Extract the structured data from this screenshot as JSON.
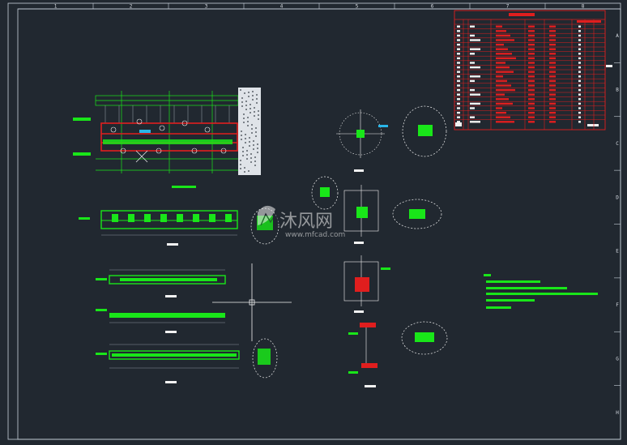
{
  "drawing": {
    "zone_columns": [
      "1",
      "2",
      "3",
      "4",
      "5",
      "6",
      "7",
      "8"
    ],
    "zone_rows": [
      "A",
      "B",
      "C",
      "D",
      "E",
      "F",
      "G",
      "H"
    ]
  },
  "watermark": {
    "brand": "沐风网",
    "url": "www.mfcad.com",
    "logo_icon": "leaf-m-logo-icon"
  },
  "colors": {
    "background": "#212830",
    "frame": "#c9d2dc",
    "green": "#19e619",
    "red": "#e01e1e",
    "white": "#f2f2f2",
    "gray": "#8a929c"
  }
}
